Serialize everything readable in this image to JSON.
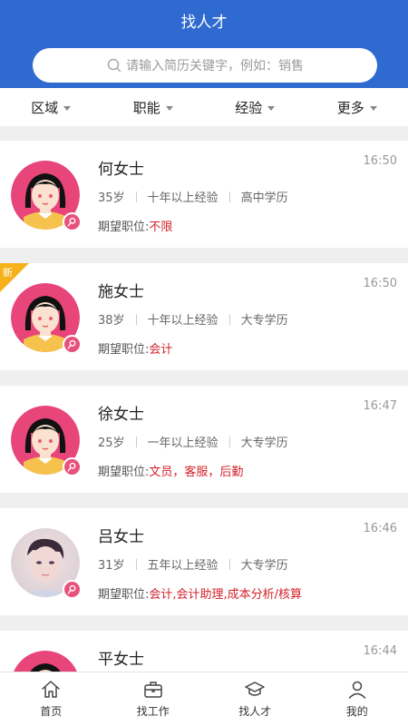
{
  "header": {
    "title": "找人才"
  },
  "search": {
    "placeholder": "请输入简历关键字，例如：销售",
    "icon": "search-icon"
  },
  "filters": [
    {
      "label": "区域"
    },
    {
      "label": "职能"
    },
    {
      "label": "经验"
    },
    {
      "label": "更多"
    }
  ],
  "candidates": [
    {
      "name": "何女士",
      "time": "16:50",
      "age": "35岁",
      "experience": "十年以上经验",
      "education": "高中学历",
      "expect_label": "期望职位:",
      "expect_value": "不限",
      "avatar": "cartoon-woman",
      "is_new": false
    },
    {
      "name": "施女士",
      "time": "16:50",
      "age": "38岁",
      "experience": "十年以上经验",
      "education": "大专学历",
      "expect_label": "期望职位:",
      "expect_value": "会计",
      "avatar": "cartoon-woman",
      "is_new": true,
      "new_label": "新"
    },
    {
      "name": "徐女士",
      "time": "16:47",
      "age": "25岁",
      "experience": "一年以上经验",
      "education": "大专学历",
      "expect_label": "期望职位:",
      "expect_value": "文员，客服，后勤",
      "avatar": "cartoon-woman",
      "is_new": false
    },
    {
      "name": "吕女士",
      "time": "16:46",
      "age": "31岁",
      "experience": "五年以上经验",
      "education": "大专学历",
      "expect_label": "期望职位:",
      "expect_value": "会计,会计助理,成本分析/核算",
      "avatar": "photo",
      "is_new": false
    },
    {
      "name": "平女士",
      "time": "16:44",
      "age": "",
      "experience": "",
      "education": "",
      "expect_label": "",
      "expect_value": "",
      "avatar": "cartoon-woman",
      "is_new": false
    }
  ],
  "tabbar": [
    {
      "label": "首页",
      "icon": "home-icon",
      "active": false
    },
    {
      "label": "找工作",
      "icon": "briefcase-icon",
      "active": false
    },
    {
      "label": "找人才",
      "icon": "graduation-cap-icon",
      "active": true
    },
    {
      "label": "我的",
      "icon": "user-icon",
      "active": false
    }
  ],
  "colors": {
    "primary": "#2f6ad0",
    "accent_red": "#d2222a",
    "female_badge": "#e7517a",
    "new_badge": "#f5b21b"
  }
}
